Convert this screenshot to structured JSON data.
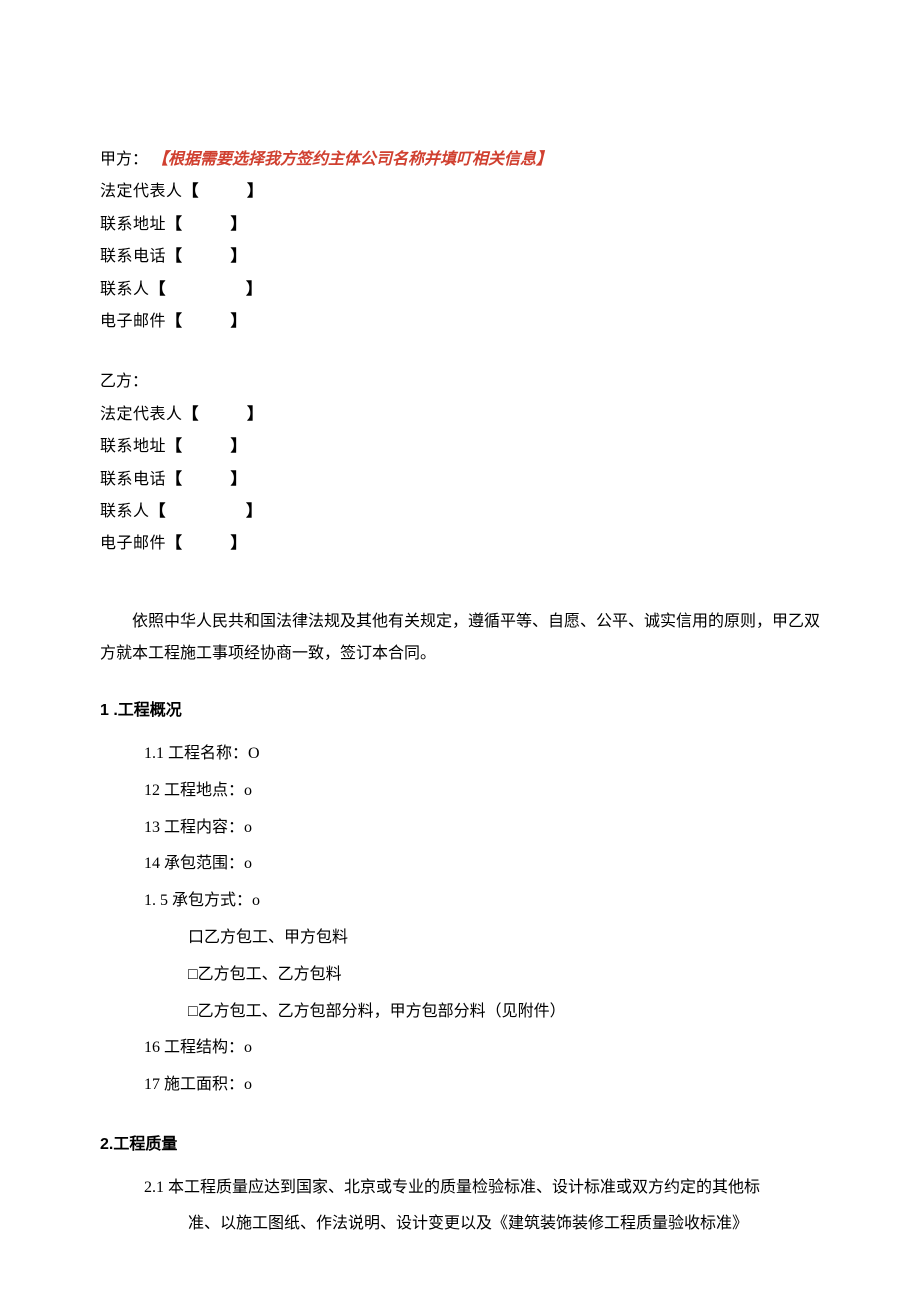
{
  "partyA": {
    "label": "甲方：",
    "note": "【根据需要选择我方签约主体公司名称并填叮相关信息】",
    "fields": [
      {
        "label": "法定代表人",
        "open": "【",
        "close": "】"
      },
      {
        "label": "联系地址",
        "open": "【",
        "close": "】"
      },
      {
        "label": "联系电话",
        "open": "【",
        "close": "】"
      },
      {
        "label": "联系人",
        "open": "【",
        "close": "】"
      },
      {
        "label": "电子邮件",
        "open": "【",
        "close": "】"
      }
    ]
  },
  "partyB": {
    "label": "乙方：",
    "fields": [
      {
        "label": "法定代表人",
        "open": "【",
        "close": "】"
      },
      {
        "label": "联系地址",
        "open": "【",
        "close": "】"
      },
      {
        "label": "联系电话",
        "open": "【",
        "close": "】"
      },
      {
        "label": "联系人",
        "open": "【",
        "close": "】"
      },
      {
        "label": "电子邮件",
        "open": "【",
        "close": "】"
      }
    ]
  },
  "preamble": "依照中华人民共和国法律法规及其他有关规定，遵循平等、自愿、公平、诚实信用的原则，甲乙双方就本工程施工事项经协商一致，签订本合同。",
  "section1": {
    "heading": "1 .工程概况",
    "items": [
      "1.1 工程名称：O",
      "12 工程地点：o",
      "13 工程内容：o",
      "14 承包范围：o",
      "1. 5 承包方式：o"
    ],
    "options": [
      "口乙方包工、甲方包料",
      "□乙方包工、乙方包料",
      "□乙方包工、乙方包部分料，甲方包部分料（见附件）"
    ],
    "items2": [
      "16 工程结构：o",
      "17 施工面积：o"
    ]
  },
  "section2": {
    "heading": "2.工程质量",
    "item_num": "2.1 ",
    "item_line1": "本工程质量应达到国家、北京或专业的质量检验标准、设计标准或双方约定的其他标",
    "item_line2": "准、以施工图纸、作法说明、设计变更以及《建筑装饰装修工程质量验收标准》"
  }
}
